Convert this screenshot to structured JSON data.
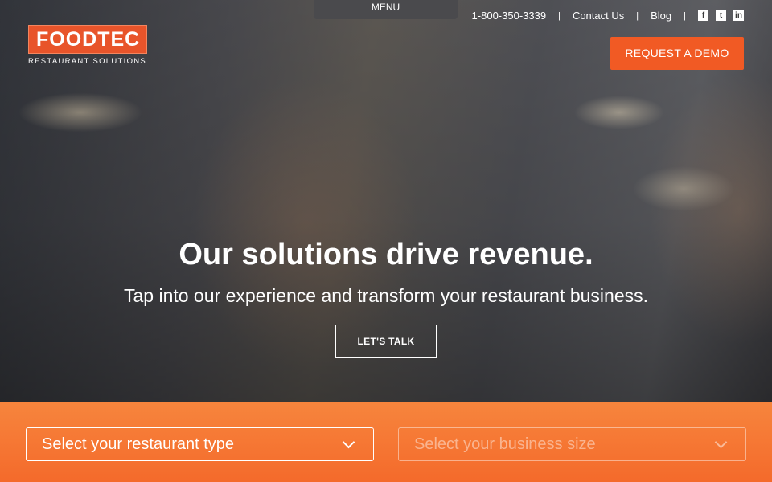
{
  "menu": {
    "label": "MENU"
  },
  "logo": {
    "name": "FOODTEC",
    "tagline": "RESTAURANT SOLUTIONS"
  },
  "topnav": {
    "phone": "1-800-350-3339",
    "contact": "Contact Us",
    "blog": "Blog",
    "social": [
      {
        "icon": "facebook-icon",
        "glyph": "f"
      },
      {
        "icon": "twitter-icon",
        "glyph": "t"
      },
      {
        "icon": "linkedin-icon",
        "glyph": "in"
      }
    ]
  },
  "cta": {
    "demo": "REQUEST A DEMO",
    "talk": "LET'S TALK"
  },
  "hero": {
    "headline": "Our solutions drive revenue.",
    "subline": "Tap into our experience and transform your restaurant business."
  },
  "filters": {
    "restaurant_type": "Select your restaurant type",
    "business_size": "Select your business size"
  },
  "colors": {
    "accent": "#f15a24",
    "band": "#f7853d"
  }
}
